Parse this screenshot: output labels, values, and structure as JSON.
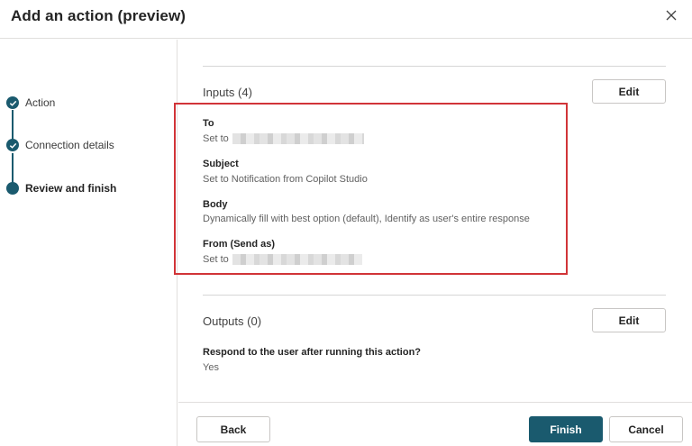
{
  "dialog": {
    "title": "Add an action (preview)"
  },
  "stepper": {
    "steps": [
      {
        "label": "Action",
        "state": "complete"
      },
      {
        "label": "Connection details",
        "state": "complete"
      },
      {
        "label": "Review and finish",
        "state": "current"
      }
    ]
  },
  "inputs": {
    "title": "Inputs (4)",
    "edit_label": "Edit",
    "fields": [
      {
        "label": "To",
        "value": "Set to",
        "redacted": true
      },
      {
        "label": "Subject",
        "value": "Set to Notification from Copilot Studio",
        "redacted": false
      },
      {
        "label": "Body",
        "value": "Dynamically fill with best option (default), Identify as user's entire response",
        "redacted": false
      },
      {
        "label": "From (Send as)",
        "value": "Set to",
        "redacted": true
      }
    ]
  },
  "outputs": {
    "title": "Outputs (0)",
    "edit_label": "Edit",
    "respond_question": "Respond to the user after running this action?",
    "respond_answer": "Yes"
  },
  "footer": {
    "back_label": "Back",
    "finish_label": "Finish",
    "cancel_label": "Cancel"
  },
  "colors": {
    "accent": "#1a5a6e",
    "highlight": "#d13438",
    "border": "#e1dfdd"
  },
  "icons": {
    "close": "close-icon",
    "step_complete": "checkmark-icon"
  }
}
